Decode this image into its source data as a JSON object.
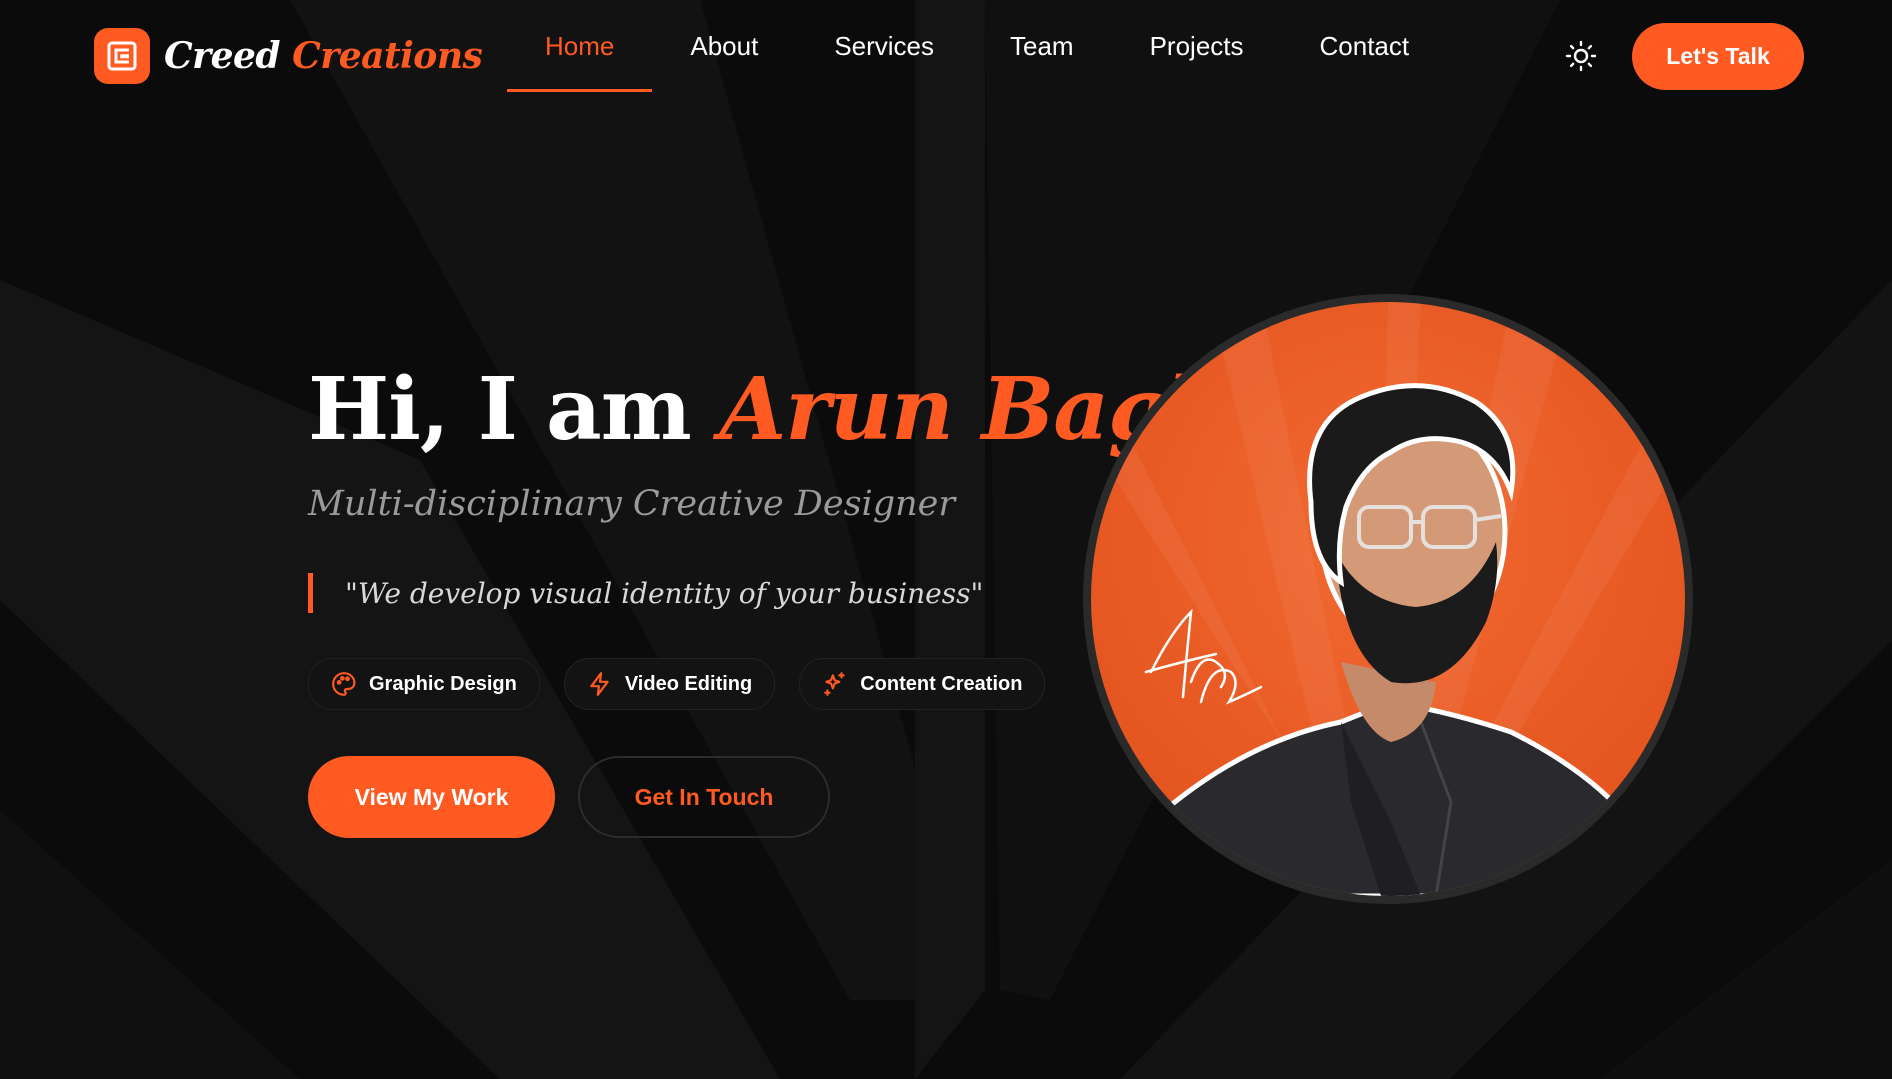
{
  "brand": {
    "word1": "Creed",
    "word2": "Creations",
    "accent": "#ff5a22",
    "logo_icon": "brand-logo-icon"
  },
  "nav": {
    "items": [
      {
        "label": "Home",
        "active": true
      },
      {
        "label": "About",
        "active": false
      },
      {
        "label": "Services",
        "active": false
      },
      {
        "label": "Team",
        "active": false
      },
      {
        "label": "Projects",
        "active": false
      },
      {
        "label": "Contact",
        "active": false
      }
    ],
    "theme_toggle_icon": "sun-icon",
    "cta_label": "Let's Talk"
  },
  "hero": {
    "greeting": "Hi, I am",
    "name": "Arun Baghel",
    "subtitle": "Multi-disciplinary Creative Designer",
    "quote": "\"We develop visual identity of your business\"",
    "tags": [
      {
        "label": "Graphic Design",
        "icon": "palette-icon"
      },
      {
        "label": "Video Editing",
        "icon": "lightning-icon"
      },
      {
        "label": "Content Creation",
        "icon": "sparkles-icon"
      }
    ],
    "primary_cta": "View My Work",
    "secondary_cta": "Get In Touch",
    "portrait": {
      "signature": "Arun Baghel",
      "background_color": "#ee5a22"
    }
  }
}
